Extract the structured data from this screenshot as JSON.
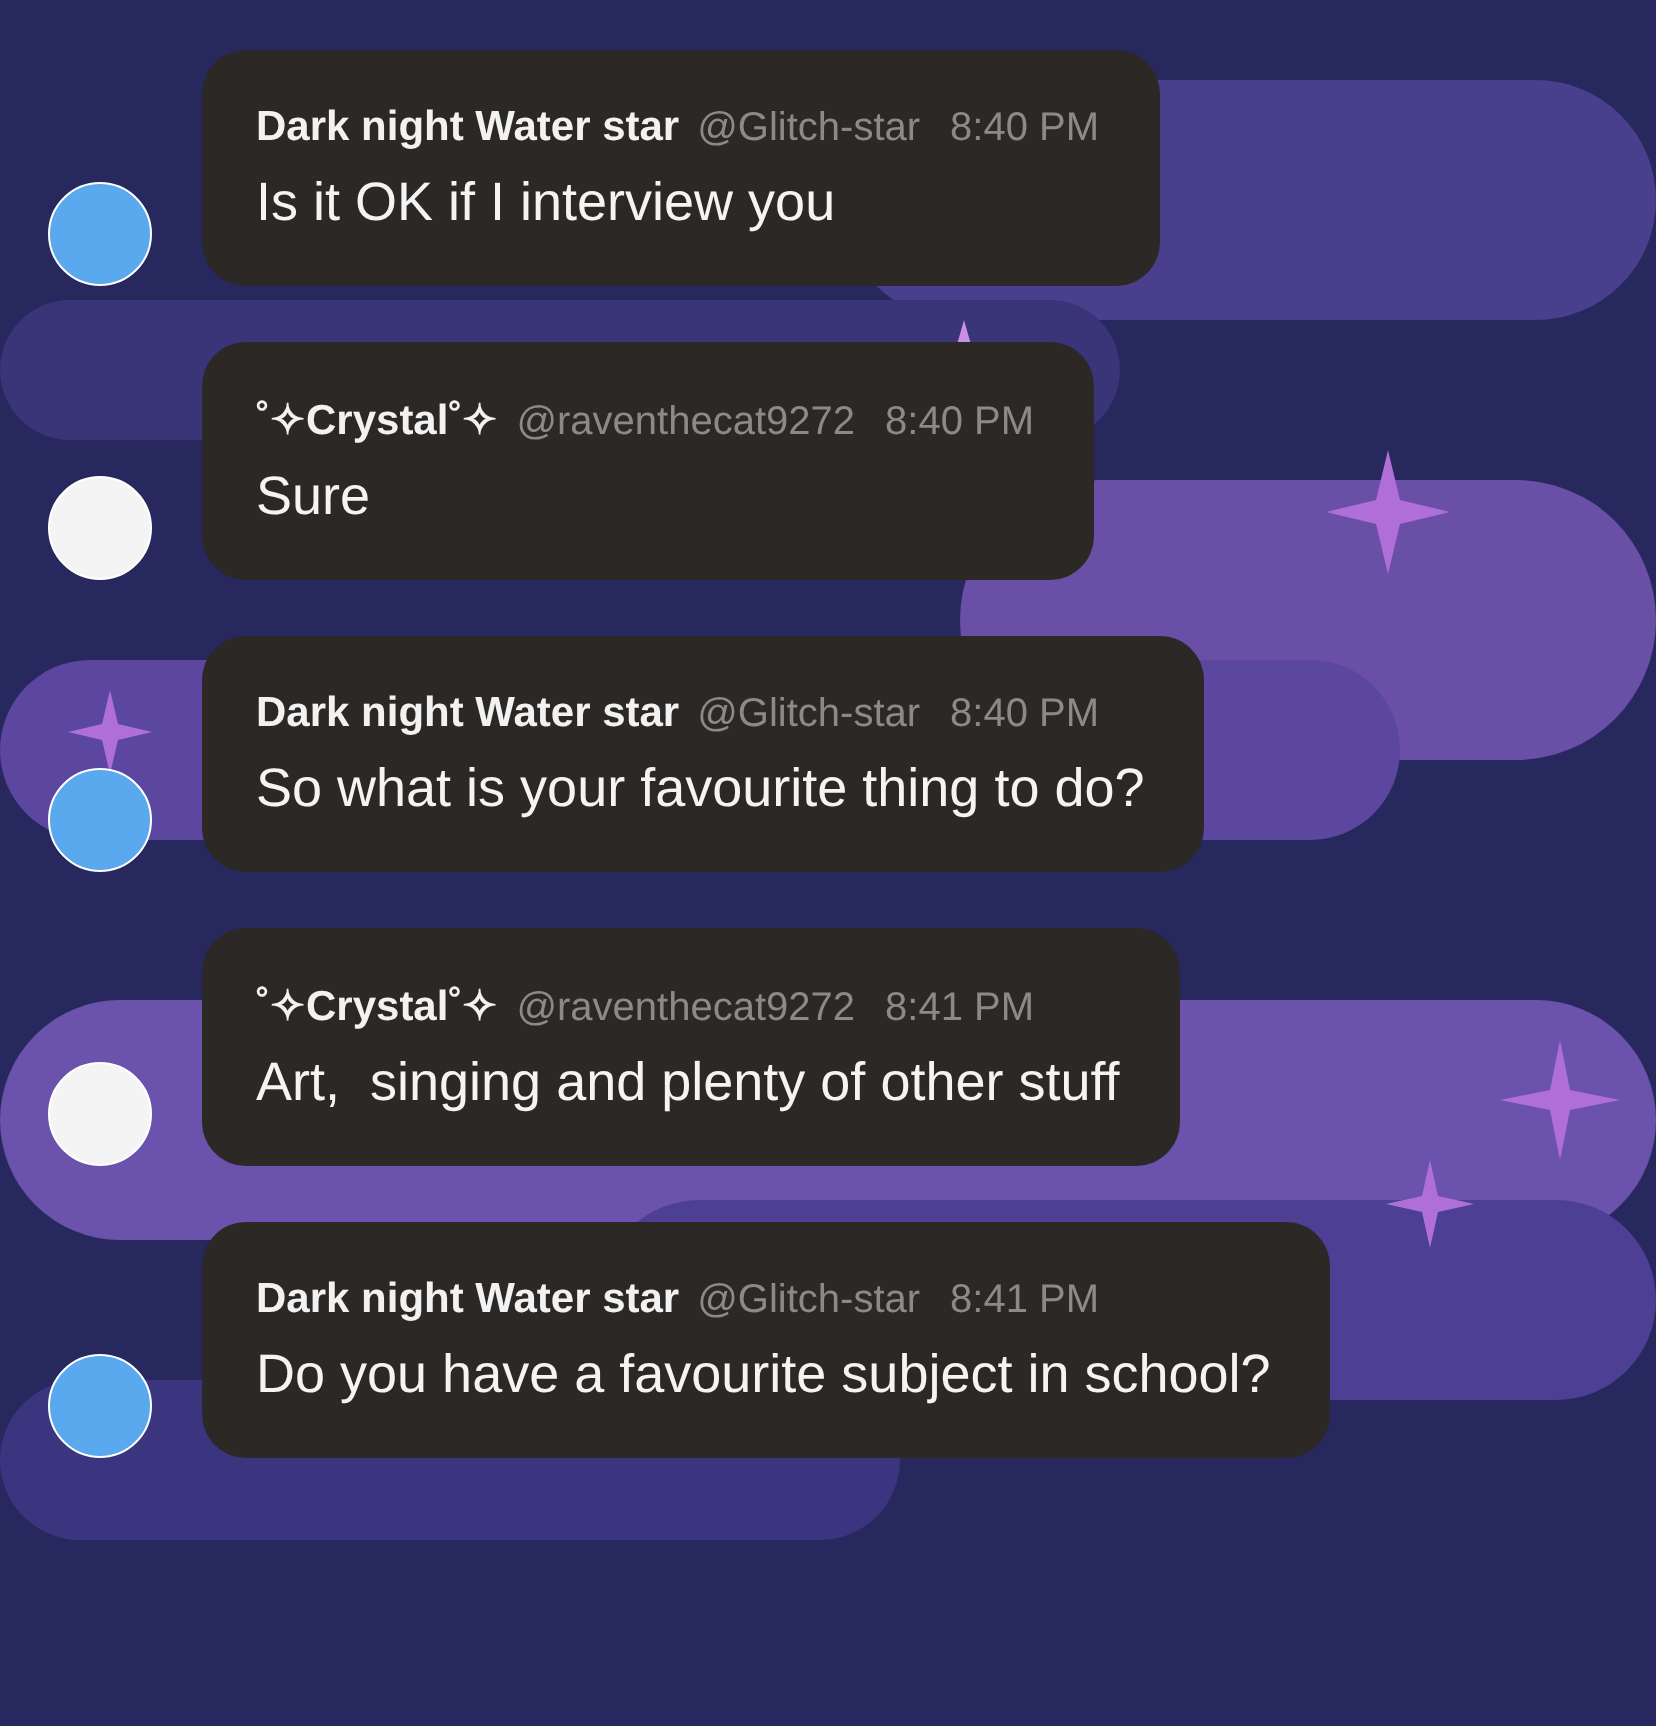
{
  "messages": [
    {
      "author": "Dark night Water star",
      "handle": "@Glitch-star",
      "time": "8:40 PM",
      "text": "Is it OK if I interview you",
      "color": "#5aa8ee"
    },
    {
      "author": "˚✧Crystal˚✧",
      "handle": "@raventhecat9272",
      "time": "8:40 PM",
      "text": "Sure",
      "color": "#f4f4f4"
    },
    {
      "author": "Dark night Water star",
      "handle": "@Glitch-star",
      "time": "8:40 PM",
      "text": "So what is your favourite thing to do?",
      "color": "#5aa8ee"
    },
    {
      "author": "˚✧Crystal˚✧",
      "handle": "@raventhecat9272",
      "time": "8:41 PM",
      "text": "Art,  singing and plenty of other stuff",
      "color": "#f4f4f4"
    },
    {
      "author": "Dark night Water star",
      "handle": "@Glitch-star",
      "time": "8:41 PM",
      "text": "Do you have a favourite subject in school?",
      "color": "#5aa8ee"
    }
  ]
}
